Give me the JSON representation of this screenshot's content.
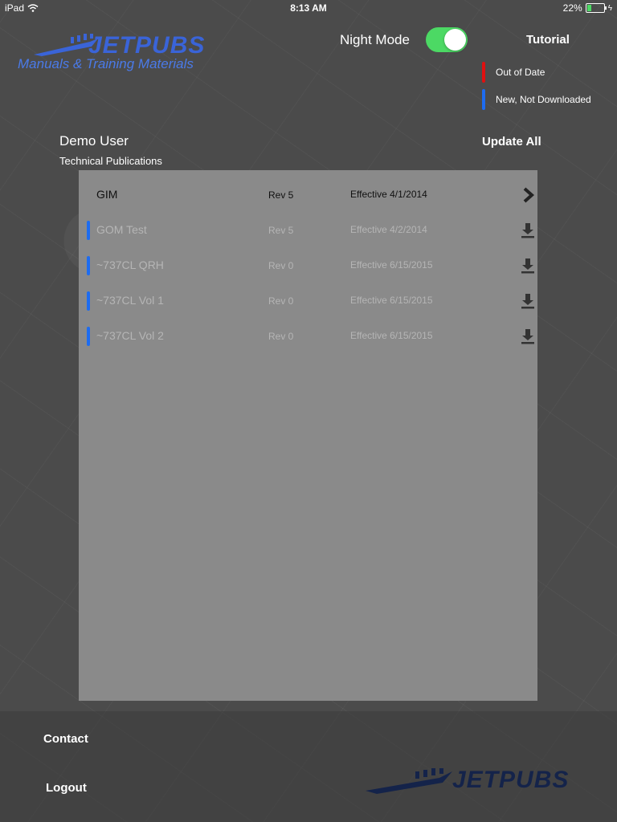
{
  "status_bar": {
    "device": "iPad",
    "time": "8:13 AM",
    "battery": "22%",
    "battery_level": 0.22
  },
  "logo": {
    "title": "JETPUBS",
    "subtitle": "Manuals & Training Materials"
  },
  "header": {
    "night_mode_label": "Night Mode",
    "night_mode_on": true,
    "tutorial_label": "Tutorial"
  },
  "legend": [
    {
      "label": "Out of Date",
      "color": "#e01010"
    },
    {
      "label": "New, Not Downloaded",
      "color": "#1e6cf0"
    }
  ],
  "user": {
    "name": "Demo User",
    "department": "Technical Publications"
  },
  "update_all_label": "Update All",
  "publications": [
    {
      "name": "GIM",
      "rev": "Rev 5",
      "effective": "Effective 4/1/2014",
      "status": "downloaded",
      "action": "open"
    },
    {
      "name": "GOM Test",
      "rev": "Rev 5",
      "effective": "Effective 4/2/2014",
      "status": "new",
      "action": "download"
    },
    {
      "name": "~737CL QRH",
      "rev": "Rev 0",
      "effective": "Effective 6/15/2015",
      "status": "new",
      "action": "download"
    },
    {
      "name": "~737CL Vol 1",
      "rev": "Rev 0",
      "effective": "Effective 6/15/2015",
      "status": "new",
      "action": "download"
    },
    {
      "name": "~737CL Vol 2",
      "rev": "Rev 0",
      "effective": "Effective 6/15/2015",
      "status": "new",
      "action": "download"
    }
  ],
  "footer": {
    "contact_label": "Contact",
    "logout_label": "Logout",
    "logo_title": "JETPUBS"
  },
  "colors": {
    "accent_blue": "#1e6cf0",
    "toggle_green": "#4cd964",
    "out_of_date_red": "#e01010"
  }
}
